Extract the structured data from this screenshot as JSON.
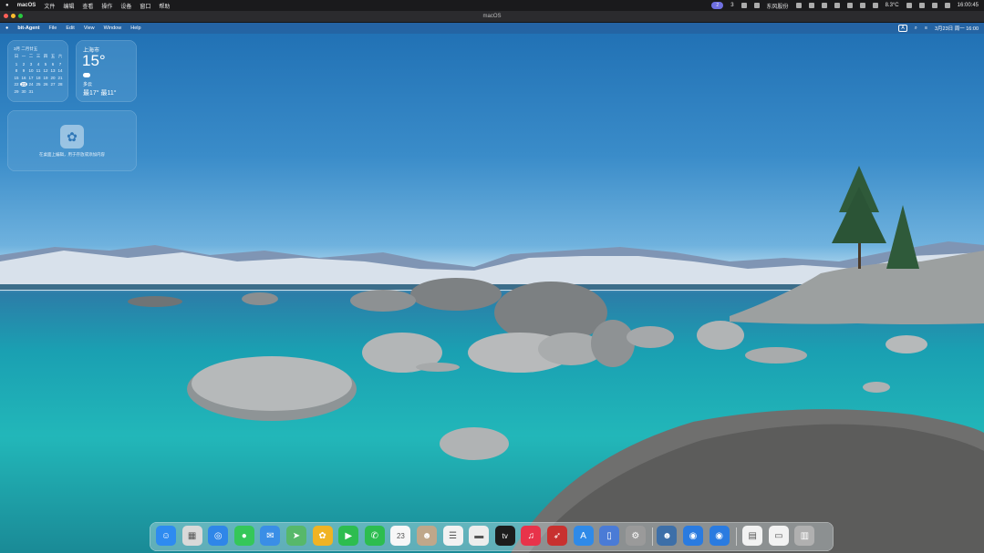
{
  "host_menubar": {
    "app": "macOS",
    "menus": [
      "文件",
      "编辑",
      "查看",
      "操作",
      "设备",
      "窗口",
      "帮助"
    ],
    "status_pill": "2",
    "status_a": "3",
    "status_text": "东风股份",
    "battery": "8.3°C",
    "clock": "16:00:45"
  },
  "vm_window": {
    "title": "macOS"
  },
  "guest_menubar": {
    "app": "bit-Agent",
    "menus": [
      "File",
      "Edit",
      "View",
      "Window",
      "Help"
    ],
    "input_indicator": "A",
    "datetime": "3月23日 周一 16:00"
  },
  "calendar_widget": {
    "header": "3月 二月廿五",
    "weekdays": [
      "日",
      "一",
      "二",
      "三",
      "四",
      "五",
      "六"
    ],
    "days": [
      "1",
      "2",
      "3",
      "4",
      "5",
      "6",
      "7",
      "8",
      "9",
      "10",
      "11",
      "12",
      "13",
      "14",
      "15",
      "16",
      "17",
      "18",
      "19",
      "20",
      "21",
      "22",
      "23",
      "24",
      "25",
      "26",
      "27",
      "28",
      "29",
      "30",
      "31"
    ],
    "today": "23"
  },
  "weather_widget": {
    "city": "上海市",
    "temp": "15°",
    "condition": "多云",
    "range": "最17° 最11°"
  },
  "placeholder_widget": {
    "text": "在桌面上编辑，用于存放或添加内容"
  },
  "dock": {
    "items": [
      {
        "name": "finder",
        "glyph": "☺",
        "color": "#2e8bf0"
      },
      {
        "name": "launchpad",
        "glyph": "▦",
        "color": "#d9d9d9"
      },
      {
        "name": "safari",
        "glyph": "◎",
        "color": "#2f86e8"
      },
      {
        "name": "messages",
        "glyph": "●",
        "color": "#35c759"
      },
      {
        "name": "mail",
        "glyph": "✉",
        "color": "#3a8ee6"
      },
      {
        "name": "maps",
        "glyph": "➤",
        "color": "#57b86a"
      },
      {
        "name": "photos",
        "glyph": "✿",
        "color": "#f0b323"
      },
      {
        "name": "facetime",
        "glyph": "▶",
        "color": "#2dbd4f"
      },
      {
        "name": "phone",
        "glyph": "✆",
        "color": "#2dbd4f"
      },
      {
        "name": "calendar",
        "glyph": "23",
        "color": "#f7f7f7"
      },
      {
        "name": "contacts",
        "glyph": "☻",
        "color": "#bfa78a"
      },
      {
        "name": "reminders",
        "glyph": "☰",
        "color": "#f2f2f2"
      },
      {
        "name": "notes",
        "glyph": "▬",
        "color": "#ededed"
      },
      {
        "name": "tv",
        "glyph": "tv",
        "color": "#1c1c1c"
      },
      {
        "name": "music",
        "glyph": "♫",
        "color": "#e8334a"
      },
      {
        "name": "rocket",
        "glyph": "➶",
        "color": "#c8312f"
      },
      {
        "name": "app-store",
        "glyph": "A",
        "color": "#2f8ae8"
      },
      {
        "name": "preview",
        "glyph": "▯",
        "color": "#4a7bd6"
      },
      {
        "name": "settings",
        "glyph": "⚙",
        "color": "#9a9a9a"
      },
      {
        "name": "agent",
        "glyph": "☻",
        "color": "#3d6fa8"
      },
      {
        "name": "browser-1",
        "glyph": "◉",
        "color": "#2a7be0"
      },
      {
        "name": "browser-2",
        "glyph": "◉",
        "color": "#2a7be0"
      },
      {
        "name": "document",
        "glyph": "▤",
        "color": "#f2f2f2"
      },
      {
        "name": "window",
        "glyph": "▭",
        "color": "#f2f2f2"
      },
      {
        "name": "trash",
        "glyph": "▥",
        "color": "#b0b0b0"
      }
    ]
  }
}
